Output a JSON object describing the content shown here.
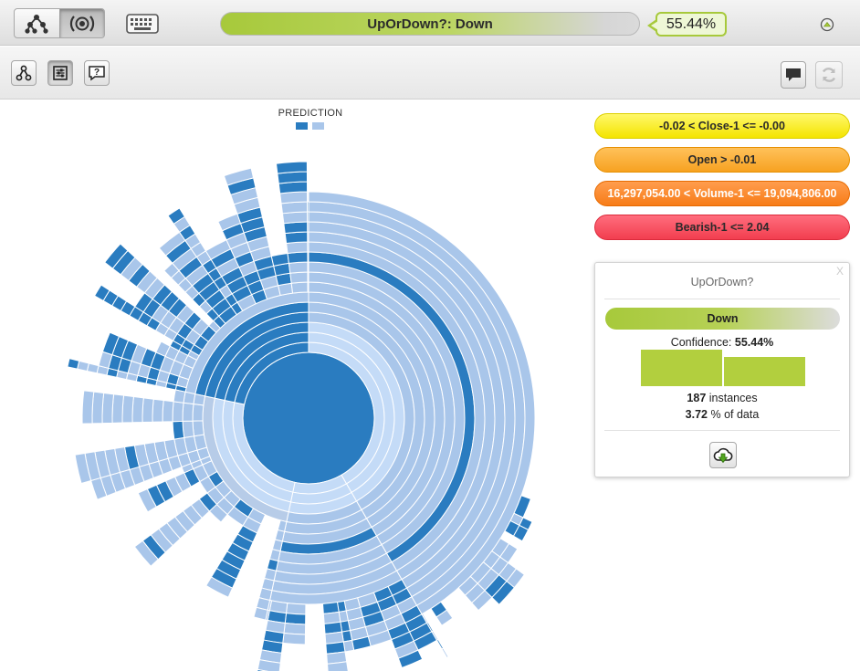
{
  "header": {
    "prediction_label": "UpOrDown?: Down",
    "confidence_badge": "55.44%"
  },
  "chart_data": {
    "type": "sunburst",
    "legend_title": "PREDICTION",
    "legend_colors": [
      "#2a7cc0",
      "#a9c6ea"
    ]
  },
  "rules": [
    {
      "label": "-0.02 < Close-1 <= -0.00",
      "color": "#f4e400"
    },
    {
      "label": "Open > -0.01",
      "color": "#f7a221"
    },
    {
      "label": "16,297,054.00 < Volume-1 <= 19,094,806.00",
      "color": "#f77c18"
    },
    {
      "label": "Bearish-1 <= 2.04",
      "color": "#f23e4f"
    }
  ],
  "panel": {
    "close": "X",
    "title": "UpOrDown?",
    "prediction": "Down",
    "confidence_label": "Confidence:",
    "confidence_value": "55.44%",
    "class_distribution": [
      0.5544,
      0.4456
    ],
    "instances_count": "187",
    "instances_label": "instances",
    "data_percent": "3.72",
    "data_percent_label": "% of data"
  },
  "icons": {
    "tree_view": "tree-icon",
    "sunburst_view": "sunburst-icon",
    "keyboard": "keyboard-icon",
    "collapse": "collapse-arrow-icon",
    "branch": "branch-icon",
    "filter": "filter-sliders-icon",
    "question": "question-icon",
    "comment": "comment-icon",
    "refresh": "refresh-icon",
    "download": "download-cloud-icon"
  }
}
